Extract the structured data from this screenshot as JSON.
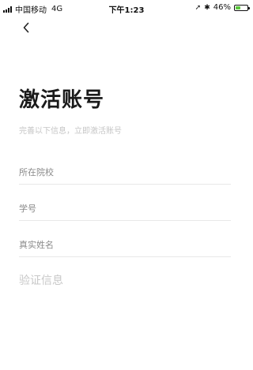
{
  "status_bar": {
    "carrier": "中国移动",
    "network": "4G",
    "time": "下午1:23",
    "battery_percent": "46%",
    "battery_level": 0.46,
    "icons": [
      "signal-icon",
      "location-icon",
      "bluetooth-icon",
      "battery-icon"
    ]
  },
  "nav": {
    "back_icon": "chevron-left-icon"
  },
  "page": {
    "title": "激活账号",
    "subtitle": "完善以下信息，立即激活账号"
  },
  "form": {
    "school_placeholder": "所在院校",
    "student_id_placeholder": "学号",
    "real_name_placeholder": "真实姓名",
    "school_value": "",
    "student_id_value": "",
    "real_name_value": ""
  },
  "verify": {
    "label": "验证信息"
  },
  "colors": {
    "background": "#ffffff",
    "title": "#1a1a1a",
    "hint": "#c6c6c6",
    "divider": "#e8e8e8",
    "battery": "#5ac63b"
  }
}
